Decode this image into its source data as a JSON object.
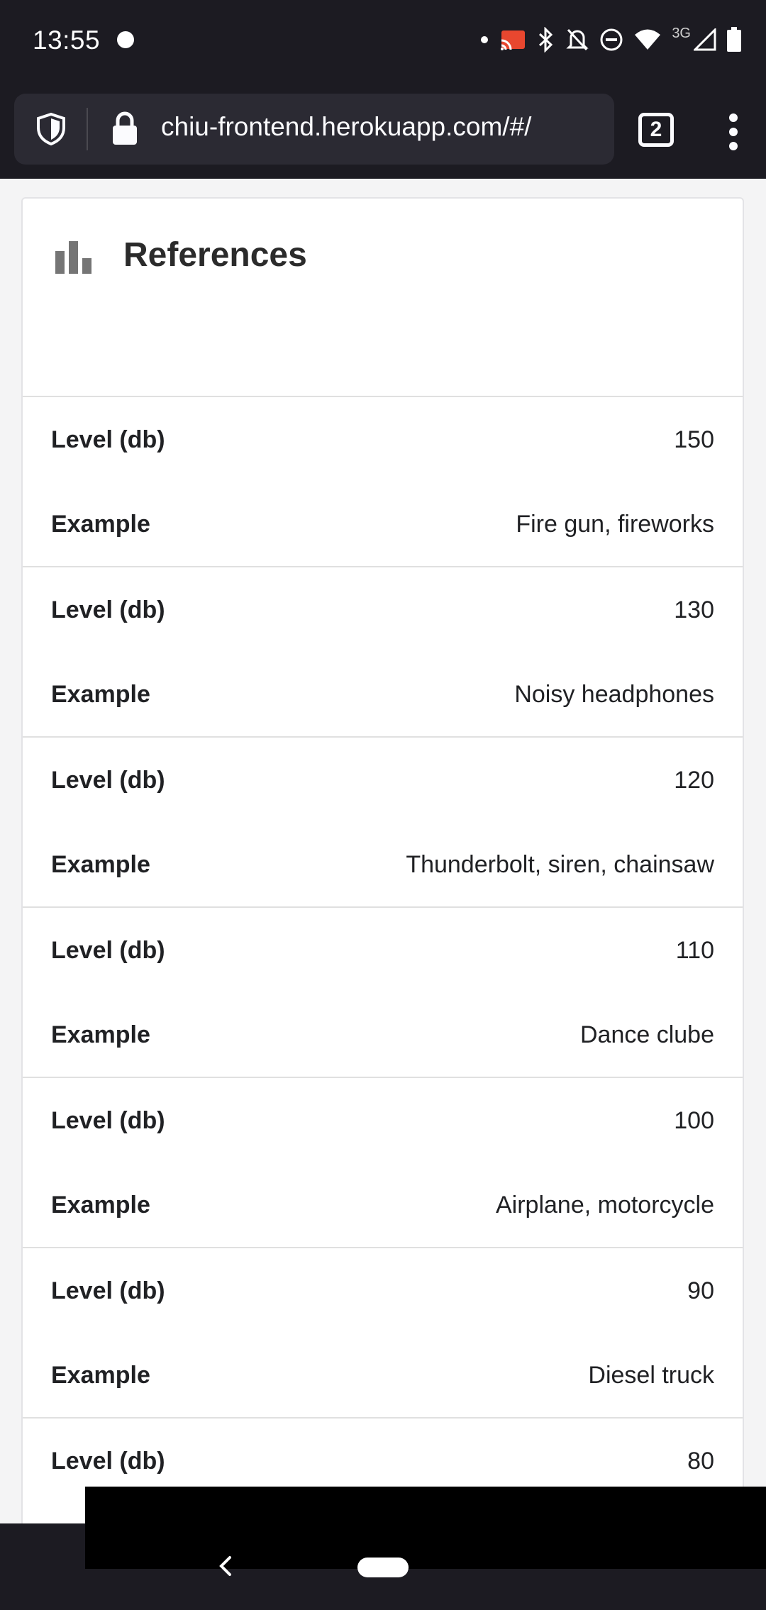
{
  "status_bar": {
    "time": "13:55",
    "network_label": "3G",
    "icons": [
      "notification-dot-icon",
      "cast-icon",
      "bluetooth-icon",
      "mute-icon",
      "do-not-disturb-icon",
      "wifi-icon",
      "signal-icon",
      "battery-icon"
    ]
  },
  "browser": {
    "url": "chiu-frontend.herokuapp.com/#/",
    "tab_count": "2"
  },
  "card": {
    "title": "References",
    "icon": "bar-chart-icon",
    "rows": [
      {
        "level_label": "Level (db)",
        "level": "150",
        "example_label": "Example",
        "example": "Fire gun, fireworks"
      },
      {
        "level_label": "Level (db)",
        "level": "130",
        "example_label": "Example",
        "example": "Noisy headphones"
      },
      {
        "level_label": "Level (db)",
        "level": "120",
        "example_label": "Example",
        "example": "Thunderbolt, siren, chainsaw"
      },
      {
        "level_label": "Level (db)",
        "level": "110",
        "example_label": "Example",
        "example": "Dance clube"
      },
      {
        "level_label": "Level (db)",
        "level": "100",
        "example_label": "Example",
        "example": "Airplane, motorcycle"
      },
      {
        "level_label": "Level (db)",
        "level": "90",
        "example_label": "Example",
        "example": "Diesel truck"
      },
      {
        "level_label": "Level (db)",
        "level": "80"
      }
    ]
  },
  "colors": {
    "chrome": "#1c1b22",
    "url_box": "#2b2a33",
    "card_bg": "#ffffff",
    "divider": "#e0e0e0",
    "text": "#202124"
  }
}
